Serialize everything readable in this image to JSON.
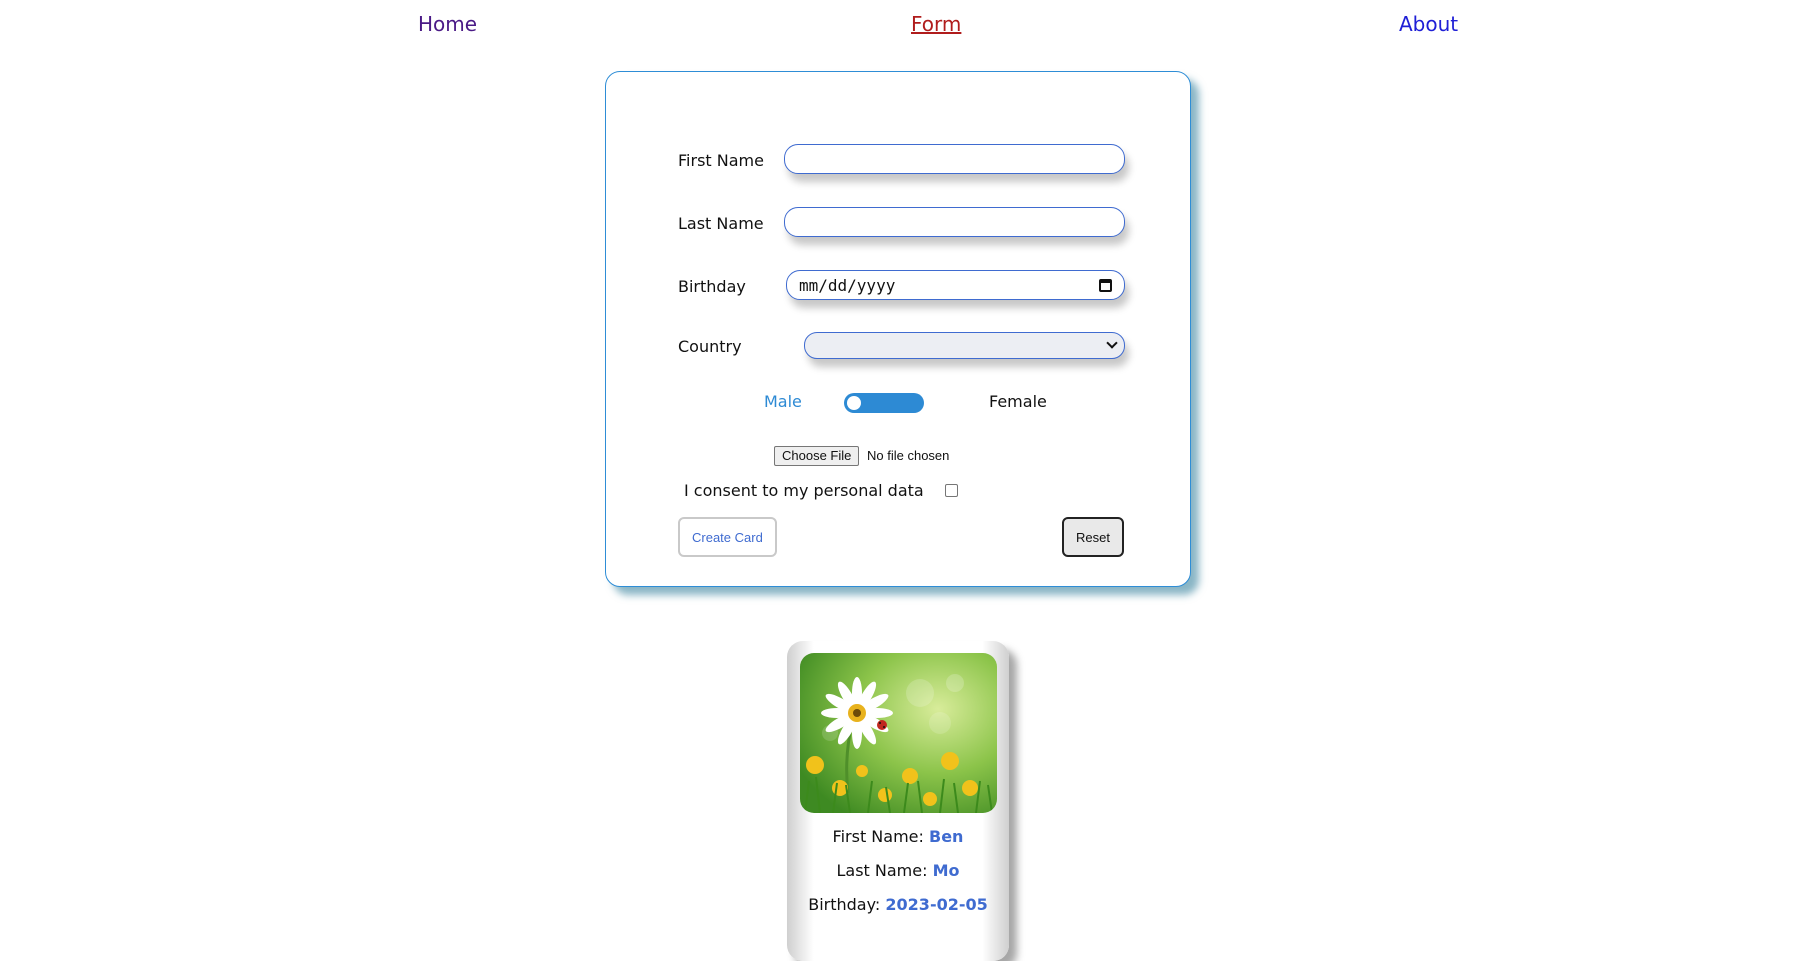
{
  "nav": {
    "home": "Home",
    "form": "Form",
    "about": "About"
  },
  "form": {
    "first_name_label": "First Name",
    "last_name_label": "Last Name",
    "birthday_label": "Birthday",
    "birthday_placeholder": "mm/dd/yyyy",
    "country_label": "Country",
    "country_value": "",
    "gender_male": "Male",
    "gender_female": "Female",
    "file_button": "Choose File",
    "file_status": "No file chosen",
    "consent_label": "I consent to my personal data",
    "create_button": "Create Card",
    "reset_button": "Reset"
  },
  "card": {
    "first_name_label": "First Name:",
    "first_name_value": "Ben",
    "last_name_label": "Last Name:",
    "last_name_value": "Mo",
    "birthday_label": "Birthday:",
    "birthday_value": "2023-02-05"
  },
  "colors": {
    "accent": "#2d8ad4",
    "link_blue": "#3f6bd0",
    "panel_border": "#2e8dd6"
  }
}
